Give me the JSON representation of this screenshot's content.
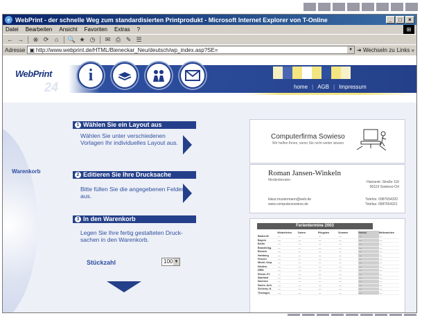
{
  "window": {
    "title": "WebPrint - der schnelle Weg zum standardisierten Printprodukt - Microsoft Internet Explorer von T-Online",
    "controls": [
      "_",
      "□",
      "×"
    ]
  },
  "menu": [
    "Datei",
    "Bearbeiten",
    "Ansicht",
    "Favoriten",
    "Extras",
    "?"
  ],
  "toolbar": [
    "←",
    "→",
    "⊗",
    "⟳",
    "⌂",
    "🔍",
    "★",
    "◷",
    "✉",
    "⎙",
    "✎",
    "☰"
  ],
  "address": {
    "label": "Adresse",
    "url": "http://www.webprint.de/HTML/Bieneckar_Neu/deutsch/wp_index.asp?SE=",
    "go": "Wechseln zu",
    "links": "Links »"
  },
  "site": {
    "logo": "WebPrint",
    "logo_number": "24",
    "top_links": [
      "home",
      "AGB",
      "Impressum"
    ],
    "top_link_separator": "|",
    "nav_icons": [
      "info-icon",
      "paper-stack-icon",
      "people-icon",
      "mail-icon"
    ],
    "info_glyph": "i",
    "sidebar_label": "Warenkorb",
    "steps": [
      {
        "number": "1",
        "title": "Wählen Sie ein Layout aus",
        "text": "Wählen Sie unter verschiedenen Vorlagen Ihr individuelles Layout aus."
      },
      {
        "number": "2",
        "title": "Editieren Sie Ihre Drucksache",
        "text": "Bitte füllen Sie die angegebenen Felder aus."
      },
      {
        "number": "3",
        "title": "In den Warenkorb",
        "text": "Legen Sie Ihre fertig gestalteten Druck-sachen in den Warenkorb."
      }
    ],
    "quantity": {
      "label": "Stückzahl",
      "value": "100"
    }
  },
  "business_card": {
    "company": "Computerfirma Sowieso",
    "slogan": "Wir helfen Ihnen, wenn Sie nicht weiter wissen",
    "name": "Roman Jansen-Winkeln",
    "role": "Medienberater",
    "street": "Hansestr. Straße 116",
    "city": "56119 Sowieso-Ort",
    "email": "klaus.mustermann@web.de",
    "web": "www.computersowieso.de",
    "phone": "Telefon: 0987654320",
    "fax": "Telefax: 0987654321"
  },
  "calendar": {
    "title": "Ferientermine 2003",
    "columns": [
      "",
      "Winterferien",
      "Ostern",
      "Pfingsten",
      "Sommer",
      "Herbst",
      "Weihnachten"
    ],
    "states": [
      "Baden-W.",
      "Bayern",
      "Berlin",
      "Brandenbg.",
      "Bremen",
      "Hamburg",
      "Hessen",
      "Meckl.-Vorp.",
      "Nieders.",
      "NRW",
      "Rheinl.-Pf.",
      "Saarland",
      "Sachsen",
      "Sachs.-Anh.",
      "Schlesw.-H.",
      "Thüringen"
    ]
  },
  "colors": {
    "brand_blue": "#24408a",
    "accent_yellow": "#f3e680",
    "page_bg": "#eef0f7"
  }
}
